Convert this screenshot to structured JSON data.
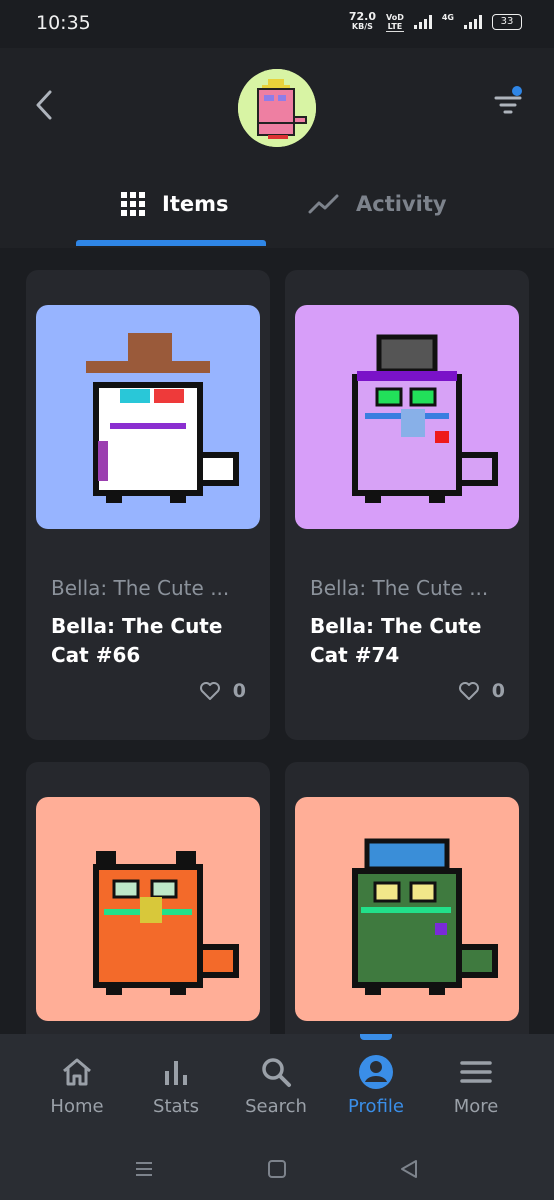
{
  "status_bar": {
    "time": "10:35",
    "speed_value": "72.0",
    "speed_unit": "KB/S",
    "volte_top": "VoD",
    "volte_bottom": "LTE",
    "network": "4G",
    "battery": "33"
  },
  "header": {
    "tabs": [
      {
        "label": "Items"
      },
      {
        "label": "Activity"
      }
    ],
    "active_tab": "Items"
  },
  "items": [
    {
      "collection": "Bella: The Cute ...",
      "title": "Bella: The Cute Cat #66",
      "likes": "0",
      "bg": "#97b4ff"
    },
    {
      "collection": "Bella: The Cute ...",
      "title": "Bella: The Cute Cat #74",
      "likes": "0",
      "bg": "#d79ef9"
    },
    {
      "bg": "#ffae97"
    },
    {
      "bg": "#ffae97"
    }
  ],
  "bottom_nav": [
    {
      "label": "Home",
      "icon": "home-icon"
    },
    {
      "label": "Stats",
      "icon": "bar-chart-icon"
    },
    {
      "label": "Search",
      "icon": "search-icon"
    },
    {
      "label": "Profile",
      "icon": "profile-icon"
    },
    {
      "label": "More",
      "icon": "menu-icon"
    }
  ],
  "active_nav": "Profile",
  "colors": {
    "accent": "#2f86e6",
    "background": "#1b1d21",
    "card": "#26282d"
  }
}
